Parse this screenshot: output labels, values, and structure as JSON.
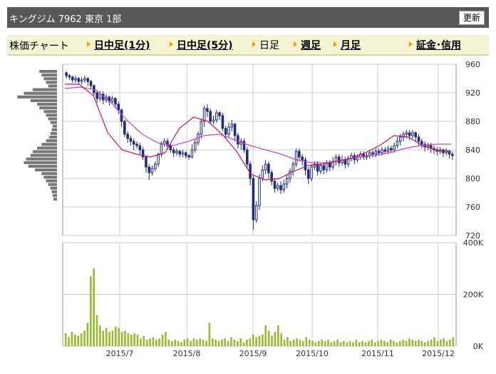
{
  "header": {
    "title": "キングジム 7962 東京 1部",
    "refresh_label": "更新"
  },
  "nav": {
    "chart_label": "株価チャート",
    "items": [
      {
        "label": "日中足(1分)",
        "active": false
      },
      {
        "label": "日中足(5分)",
        "active": false
      },
      {
        "label": "日足",
        "active": true
      },
      {
        "label": "週足",
        "active": false
      },
      {
        "label": "月足",
        "active": false
      },
      {
        "label": "証金･信用",
        "active": false
      }
    ]
  },
  "colors": {
    "candle": "#1f2d78",
    "ma_short": "#cc1166",
    "ma_long": "#cc44cc",
    "volume": "#99bb33",
    "volume_profile": "#777777",
    "grid": "#cccccc"
  },
  "chart_data": [
    {
      "type": "candlestick",
      "x_labels": [
        "2015/7",
        "2015/8",
        "2015/9",
        "2015/10",
        "2015/11",
        "2015/12"
      ],
      "ylim": [
        720,
        960
      ],
      "y_ticks": [
        960,
        920,
        880,
        840,
        800,
        760,
        720
      ],
      "grid": true,
      "candles": [
        [
          948,
          944,
          950,
          940
        ],
        [
          944,
          942,
          946,
          938
        ],
        [
          942,
          938,
          944,
          934
        ],
        [
          938,
          940,
          944,
          934
        ],
        [
          940,
          936,
          942,
          932
        ],
        [
          936,
          938,
          942,
          932
        ],
        [
          938,
          940,
          944,
          934
        ],
        [
          940,
          936,
          942,
          930
        ],
        [
          936,
          930,
          938,
          926
        ],
        [
          930,
          920,
          932,
          916
        ],
        [
          920,
          912,
          924,
          906
        ],
        [
          912,
          918,
          922,
          908
        ],
        [
          918,
          910,
          922,
          904
        ],
        [
          910,
          914,
          918,
          906
        ],
        [
          914,
          908,
          916,
          902
        ],
        [
          908,
          912,
          916,
          904
        ],
        [
          912,
          904,
          914,
          898
        ],
        [
          904,
          896,
          908,
          890
        ],
        [
          896,
          880,
          898,
          872
        ],
        [
          880,
          862,
          882,
          858
        ],
        [
          862,
          856,
          866,
          850
        ],
        [
          856,
          852,
          860,
          846
        ],
        [
          852,
          848,
          856,
          840
        ],
        [
          848,
          846,
          852,
          842
        ],
        [
          846,
          840,
          850,
          834
        ],
        [
          840,
          830,
          844,
          826
        ],
        [
          830,
          816,
          832,
          808
        ],
        [
          816,
          808,
          820,
          798
        ],
        [
          808,
          814,
          818,
          804
        ],
        [
          814,
          820,
          824,
          810
        ],
        [
          820,
          834,
          836,
          816
        ],
        [
          834,
          848,
          852,
          830
        ],
        [
          848,
          852,
          856,
          844
        ],
        [
          852,
          846,
          856,
          840
        ],
        [
          846,
          840,
          850,
          836
        ],
        [
          840,
          836,
          844,
          830
        ],
        [
          836,
          838,
          842,
          832
        ],
        [
          838,
          834,
          840,
          830
        ],
        [
          834,
          836,
          840,
          830
        ],
        [
          836,
          832,
          838,
          828
        ],
        [
          832,
          830,
          834,
          826
        ],
        [
          830,
          840,
          848,
          828
        ],
        [
          840,
          850,
          856,
          836
        ],
        [
          850,
          862,
          866,
          846
        ],
        [
          862,
          880,
          884,
          856
        ],
        [
          880,
          898,
          902,
          872
        ],
        [
          898,
          894,
          904,
          886
        ],
        [
          894,
          880,
          898,
          876
        ],
        [
          880,
          882,
          888,
          876
        ],
        [
          882,
          892,
          896,
          878
        ],
        [
          892,
          888,
          894,
          882
        ],
        [
          888,
          870,
          892,
          866
        ],
        [
          870,
          862,
          874,
          856
        ],
        [
          862,
          872,
          878,
          858
        ],
        [
          872,
          876,
          882,
          866
        ],
        [
          876,
          860,
          878,
          852
        ],
        [
          860,
          848,
          864,
          842
        ],
        [
          848,
          852,
          856,
          840
        ],
        [
          852,
          840,
          856,
          836
        ],
        [
          840,
          820,
          844,
          814
        ],
        [
          820,
          800,
          824,
          790
        ],
        [
          800,
          742,
          804,
          728
        ],
        [
          742,
          762,
          768,
          738
        ],
        [
          762,
          800,
          806,
          756
        ],
        [
          800,
          812,
          818,
          796
        ],
        [
          812,
          820,
          826,
          806
        ],
        [
          820,
          808,
          824,
          800
        ],
        [
          808,
          796,
          812,
          790
        ],
        [
          796,
          786,
          800,
          780
        ],
        [
          786,
          790,
          794,
          782
        ],
        [
          790,
          784,
          796,
          778
        ],
        [
          784,
          792,
          798,
          780
        ],
        [
          792,
          800,
          806,
          786
        ],
        [
          800,
          810,
          814,
          794
        ],
        [
          810,
          820,
          824,
          804
        ],
        [
          820,
          838,
          842,
          816
        ],
        [
          838,
          830,
          842,
          824
        ],
        [
          830,
          826,
          834,
          818
        ],
        [
          826,
          812,
          830,
          804
        ],
        [
          812,
          800,
          816,
          792
        ],
        [
          800,
          816,
          820,
          796
        ],
        [
          816,
          820,
          824,
          812
        ],
        [
          820,
          810,
          824,
          804
        ],
        [
          810,
          818,
          822,
          806
        ],
        [
          818,
          812,
          822,
          806
        ],
        [
          812,
          822,
          826,
          808
        ],
        [
          822,
          816,
          826,
          810
        ],
        [
          816,
          824,
          830,
          812
        ],
        [
          824,
          830,
          834,
          818
        ],
        [
          830,
          822,
          834,
          816
        ],
        [
          822,
          826,
          832,
          818
        ],
        [
          826,
          820,
          830,
          814
        ],
        [
          820,
          828,
          832,
          816
        ],
        [
          828,
          832,
          836,
          824
        ],
        [
          832,
          826,
          836,
          820
        ],
        [
          826,
          830,
          834,
          822
        ],
        [
          830,
          834,
          838,
          826
        ],
        [
          834,
          830,
          838,
          826
        ],
        [
          830,
          832,
          836,
          826
        ],
        [
          832,
          836,
          840,
          828
        ],
        [
          836,
          834,
          840,
          830
        ],
        [
          834,
          838,
          842,
          830
        ],
        [
          838,
          836,
          842,
          832
        ],
        [
          836,
          840,
          844,
          832
        ],
        [
          840,
          838,
          844,
          834
        ],
        [
          838,
          842,
          846,
          834
        ],
        [
          842,
          840,
          846,
          836
        ],
        [
          840,
          846,
          850,
          836
        ],
        [
          846,
          852,
          858,
          842
        ],
        [
          852,
          858,
          862,
          846
        ],
        [
          858,
          862,
          866,
          852
        ],
        [
          862,
          864,
          868,
          856
        ],
        [
          864,
          860,
          868,
          854
        ],
        [
          860,
          864,
          868,
          856
        ],
        [
          864,
          858,
          866,
          852
        ],
        [
          858,
          852,
          862,
          846
        ],
        [
          852,
          848,
          856,
          842
        ],
        [
          848,
          844,
          852,
          838
        ],
        [
          844,
          846,
          850,
          840
        ],
        [
          846,
          842,
          850,
          836
        ],
        [
          842,
          840,
          846,
          834
        ],
        [
          840,
          838,
          844,
          832
        ],
        [
          838,
          840,
          844,
          834
        ],
        [
          840,
          836,
          842,
          830
        ],
        [
          836,
          838,
          842,
          832
        ],
        [
          838,
          834,
          840,
          828
        ],
        [
          834,
          832,
          838,
          826
        ]
      ],
      "ma_short": [
        [
          0,
          932
        ],
        [
          10,
          932
        ],
        [
          20,
          916
        ],
        [
          30,
          864
        ],
        [
          40,
          840
        ],
        [
          50,
          834
        ],
        [
          60,
          830
        ],
        [
          70,
          836
        ],
        [
          80,
          870
        ],
        [
          90,
          886
        ],
        [
          100,
          880
        ],
        [
          110,
          862
        ],
        [
          120,
          838
        ],
        [
          130,
          806
        ],
        [
          140,
          798
        ],
        [
          150,
          800
        ],
        [
          160,
          810
        ],
        [
          170,
          818
        ],
        [
          180,
          820
        ],
        [
          190,
          824
        ],
        [
          200,
          828
        ],
        [
          210,
          836
        ],
        [
          220,
          846
        ],
        [
          230,
          860
        ],
        [
          240,
          858
        ],
        [
          250,
          846
        ],
        [
          260,
          840
        ],
        [
          270,
          838
        ]
      ],
      "ma_long": [
        [
          0,
          926
        ],
        [
          20,
          928
        ],
        [
          40,
          924
        ],
        [
          60,
          906
        ],
        [
          80,
          882
        ],
        [
          100,
          862
        ],
        [
          120,
          850
        ],
        [
          140,
          846
        ],
        [
          160,
          852
        ],
        [
          180,
          860
        ],
        [
          200,
          862
        ],
        [
          220,
          854
        ],
        [
          240,
          846
        ],
        [
          260,
          840
        ],
        [
          280,
          834
        ],
        [
          300,
          826
        ],
        [
          320,
          822
        ],
        [
          340,
          822
        ],
        [
          360,
          826
        ],
        [
          380,
          830
        ],
        [
          400,
          832
        ],
        [
          420,
          836
        ],
        [
          440,
          842
        ],
        [
          460,
          846
        ],
        [
          480,
          848
        ],
        [
          500,
          848
        ]
      ],
      "volume_profile": [
        0.4,
        0.35,
        0.3,
        0.25,
        0.2,
        0.55,
        0.75,
        0.9,
        0.6,
        0.45,
        0.4,
        0.3,
        0.25,
        0.2,
        0.15,
        0.1,
        0.12,
        0.15,
        0.18,
        0.25,
        0.35,
        0.45,
        0.55,
        0.6,
        0.7,
        0.75,
        0.65,
        0.5,
        0.35,
        0.3,
        0.25,
        0.2,
        0.15,
        0.12,
        0.1,
        0.08
      ]
    },
    {
      "type": "bar",
      "ylim": [
        0,
        400000
      ],
      "y_ticks": [
        "400K",
        "200K",
        "0K"
      ],
      "values": [
        50000,
        35000,
        55000,
        45000,
        40000,
        50000,
        60000,
        90000,
        270000,
        300000,
        120000,
        80000,
        60000,
        70000,
        55000,
        60000,
        75000,
        70000,
        55000,
        60000,
        50000,
        45000,
        50000,
        45000,
        30000,
        40000,
        25000,
        30000,
        35000,
        25000,
        30000,
        45000,
        55000,
        25000,
        20000,
        25000,
        20000,
        15000,
        25000,
        30000,
        20000,
        30000,
        25000,
        30000,
        25000,
        20000,
        90000,
        30000,
        25000,
        20000,
        25000,
        30000,
        20000,
        35000,
        25000,
        20000,
        30000,
        15000,
        25000,
        30000,
        45000,
        35000,
        40000,
        45000,
        80000,
        60000,
        40000,
        55000,
        80000,
        50000,
        25000,
        35000,
        20000,
        25000,
        30000,
        25000,
        20000,
        35000,
        25000,
        20000,
        15000,
        20000,
        25000,
        20000,
        25000,
        15000,
        20000,
        25000,
        15000,
        20000,
        15000,
        20000,
        15000,
        25000,
        15000,
        20000,
        15000,
        20000,
        25000,
        15000,
        20000,
        25000,
        20000,
        15000,
        25000,
        20000,
        15000,
        20000,
        25000,
        20000,
        30000,
        25000,
        20000,
        25000,
        20000,
        15000,
        20000,
        25000,
        35000,
        20000,
        25000,
        30000,
        20000,
        25000,
        35000
      ]
    }
  ]
}
